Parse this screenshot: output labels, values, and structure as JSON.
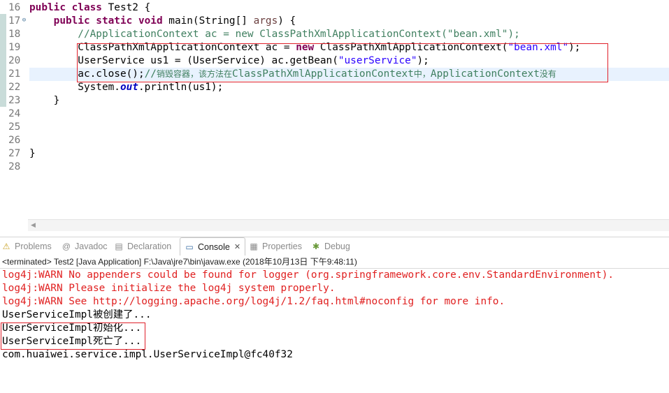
{
  "editor": {
    "lines": [
      {
        "num": "16",
        "code": [
          {
            "t": "public class ",
            "c": "kw"
          },
          {
            "t": "Test2 {",
            "c": ""
          }
        ]
      },
      {
        "num": "17",
        "fold": "⊖",
        "code": [
          {
            "t": "    ",
            "c": ""
          },
          {
            "t": "public static void ",
            "c": "kw"
          },
          {
            "t": "main(String[] ",
            "c": ""
          },
          {
            "t": "args",
            "c": "var"
          },
          {
            "t": ") {",
            "c": ""
          }
        ]
      },
      {
        "num": "18",
        "code": [
          {
            "t": "        //ApplicationContext ",
            "c": "cmt"
          },
          {
            "t": "ac",
            "c": "cmt"
          },
          {
            "t": " = new ClassPathXmlApplicationContext(\"bean.xml\");",
            "c": "cmt"
          }
        ]
      },
      {
        "num": "19",
        "code": [
          {
            "t": "        ClassPathXmlApplicationContext ac = ",
            "c": ""
          },
          {
            "t": "new ",
            "c": "kw"
          },
          {
            "t": "ClassPathXmlApplicationContext(",
            "c": ""
          },
          {
            "t": "\"bean.xml\"",
            "c": "str"
          },
          {
            "t": ");",
            "c": ""
          }
        ]
      },
      {
        "num": "20",
        "code": [
          {
            "t": "        UserService us1 = (UserService) ac.getBean(",
            "c": ""
          },
          {
            "t": "\"userService\"",
            "c": "str"
          },
          {
            "t": ");",
            "c": ""
          }
        ]
      },
      {
        "num": "21",
        "code": [
          {
            "t": "        ac.close();",
            "c": ""
          },
          {
            "t": "//",
            "c": "cmt"
          },
          {
            "t": "销毁容器，该方法在",
            "c": "cmtcjk"
          },
          {
            "t": "ClassPathXmlApplicationContext",
            "c": "cmt"
          },
          {
            "t": "中，",
            "c": "cmtcjk"
          },
          {
            "t": "ApplicationContext",
            "c": "cmt"
          },
          {
            "t": "没有",
            "c": "cmtcjk"
          }
        ]
      },
      {
        "num": "22",
        "code": [
          {
            "t": "        System.",
            "c": ""
          },
          {
            "t": "out",
            "c": "it"
          },
          {
            "t": ".println(us1);",
            "c": ""
          }
        ]
      },
      {
        "num": "23",
        "code": [
          {
            "t": "    }",
            "c": ""
          }
        ]
      },
      {
        "num": "24",
        "code": []
      },
      {
        "num": "25",
        "code": []
      },
      {
        "num": "26",
        "code": []
      },
      {
        "num": "27",
        "code": [
          {
            "t": "}",
            "c": ""
          }
        ]
      },
      {
        "num": "28",
        "code": []
      }
    ]
  },
  "views": {
    "tabs": [
      {
        "label": "Problems",
        "icon": "problems-icon",
        "glyph": "⚠",
        "color": "#c9a227"
      },
      {
        "label": "Javadoc",
        "icon": "javadoc-icon",
        "glyph": "@",
        "color": "#8a8a8a"
      },
      {
        "label": "Declaration",
        "icon": "declaration-icon",
        "glyph": "▤",
        "color": "#8a8a8a"
      },
      {
        "label": "Console",
        "icon": "console-icon",
        "glyph": "▭",
        "color": "#3a6ea5"
      },
      {
        "label": "Properties",
        "icon": "properties-icon",
        "glyph": "▦",
        "color": "#8a8a8a"
      },
      {
        "label": "Debug",
        "icon": "debug-icon",
        "glyph": "✱",
        "color": "#6a9a3a"
      }
    ],
    "active": "Console"
  },
  "console": {
    "status": "<terminated> Test2 [Java Application] F:\\Java\\jre7\\bin\\javaw.exe (2018年10月13日 下午9:48:11)",
    "lines": [
      {
        "text": "log4j:WARN No appenders could be found for logger (org.springframework.core.env.StandardEnvironment).",
        "type": "err"
      },
      {
        "text": "log4j:WARN Please initialize the log4j system properly.",
        "type": "err"
      },
      {
        "text": "log4j:WARN See http://logging.apache.org/log4j/1.2/faq.html#noconfig for more info.",
        "type": "err"
      },
      {
        "text": "UserServiceImpl被创建了...",
        "type": "out"
      },
      {
        "text": "UserServiceImpl初始化...",
        "type": "out"
      },
      {
        "text": "UserServiceImpl死亡了...",
        "type": "out"
      },
      {
        "text": "com.huaiwei.service.impl.UserServiceImpl@fc40f32",
        "type": "out"
      }
    ]
  },
  "colors": {
    "keyword": "#7f0055",
    "string": "#2a00ff",
    "comment": "#3f7f5f",
    "error": "#e02020",
    "annotation_box": "#e0202a"
  }
}
